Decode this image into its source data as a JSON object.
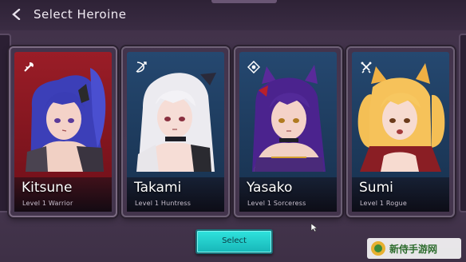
{
  "header": {
    "title": "Select Heroine",
    "back_icon": "chevron-left-icon"
  },
  "heroines": [
    {
      "name": "Kitsune",
      "level": "Level 1 Warrior",
      "class_icon": "axe-icon",
      "card_color": "#8a1620",
      "selected": true
    },
    {
      "name": "Takami",
      "level": "Level 1 Huntress",
      "class_icon": "bow-icon",
      "card_color": "#1c3a5a",
      "selected": false
    },
    {
      "name": "Yasako",
      "level": "Level 1 Sorceress",
      "class_icon": "magic-eye-icon",
      "card_color": "#1c3a5a",
      "selected": false
    },
    {
      "name": "Sumi",
      "level": "Level 1 Rogue",
      "class_icon": "daggers-icon",
      "card_color": "#1c3a5a",
      "selected": false
    }
  ],
  "actions": {
    "select_label": "Select"
  },
  "watermark": {
    "text": "新侍手游网"
  },
  "colors": {
    "accent": "#22cfcc",
    "background": "#45364f"
  }
}
